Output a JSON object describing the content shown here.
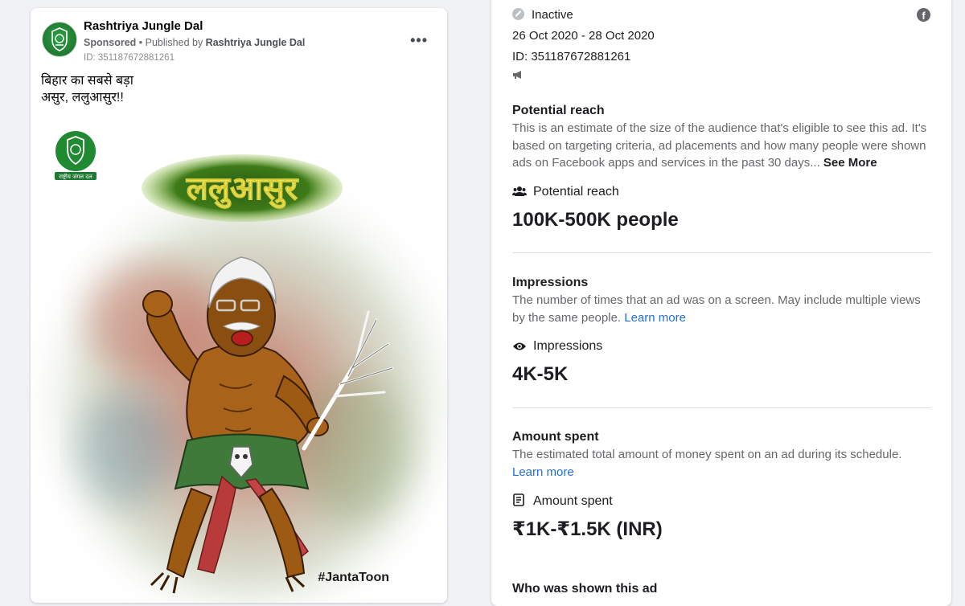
{
  "ad": {
    "page_name": "Rashtriya Jungle Dal",
    "sponsored": "Sponsored",
    "published_by_prefix": " • Published by ",
    "published_by": "Rashtriya Jungle Dal",
    "id_text": "ID: 351187672881261",
    "more_icon": "•••",
    "text_line1": "बिहार का सबसे बड़ा",
    "text_line2": "असुर, ललुआसुर!!",
    "creative": {
      "title": "ललुआसुर",
      "logo_caption": "राष्ट्रीय जंगल दल",
      "watermark": "#JantaToon"
    }
  },
  "details": {
    "status": "Inactive",
    "date_range": "26 Oct 2020 - 28 Oct 2020",
    "library_id": "ID: 351187672881261",
    "platform_icon": "f",
    "potential_reach": {
      "title": "Potential reach",
      "desc": "This is an estimate of the size of the audience that's eligible to see this ad. It's based on targeting criteria, ad placements and how many people were shown ads on Facebook apps and services in the past 30 days...",
      "see_more": "See More",
      "label": "Potential reach",
      "value": "100K-500K people"
    },
    "impressions": {
      "title": "Impressions",
      "desc": "The number of times that an ad was on a screen. May include multiple views by the same people.",
      "learn_more": "Learn more",
      "label": "Impressions",
      "value": "4K-5K"
    },
    "amount_spent": {
      "title": "Amount spent",
      "desc": "The estimated total amount of money spent on an ad during its schedule.",
      "learn_more": "Learn more",
      "label": "Amount spent",
      "value": "₹1K-₹1.5K (INR)"
    },
    "who_shown_title": "Who was shown this ad"
  },
  "colors": {
    "link": "#216fdb",
    "secondary_text": "#65676b",
    "party_green": "#1f7a32"
  }
}
